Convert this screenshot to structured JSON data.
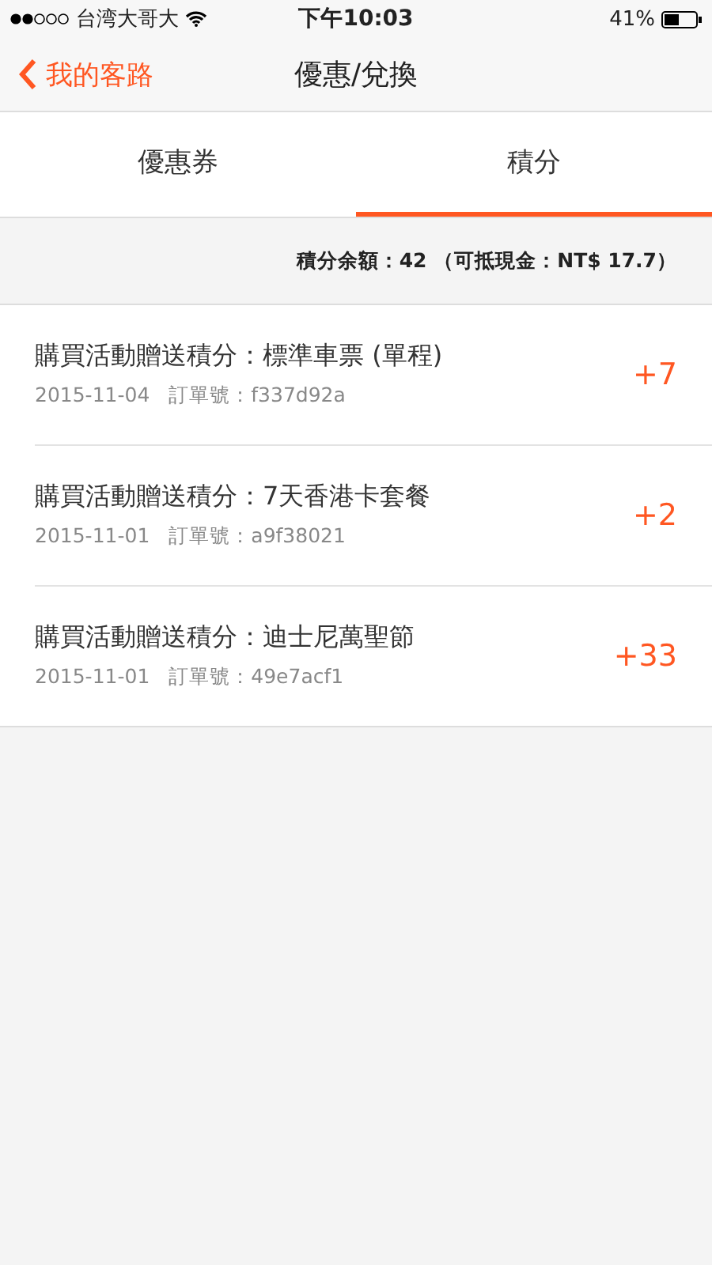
{
  "status_bar": {
    "carrier": "台湾大哥大",
    "time": "下午10:03",
    "battery": "41%"
  },
  "nav": {
    "back": "我的客路",
    "title": "優惠/兌換"
  },
  "tabs": [
    {
      "label": "優惠券",
      "selected": false
    },
    {
      "label": "積分",
      "selected": true
    }
  ],
  "balance": "積分余額：42 （可抵現金：NT$ 17.7）",
  "records": [
    {
      "title": "購買活動贈送積分：標準車票 (單程)",
      "date": "2015-11-04",
      "order": "訂單號：f337d92a",
      "points": "+7"
    },
    {
      "title": "購買活動贈送積分：7天香港卡套餐",
      "date": "2015-11-01",
      "order": "訂單號：a9f38021",
      "points": "+2"
    },
    {
      "title": "購買活動贈送積分：迪士尼萬聖節",
      "date": "2015-11-01",
      "order": "訂單號：49e7acf1",
      "points": "+33"
    }
  ]
}
